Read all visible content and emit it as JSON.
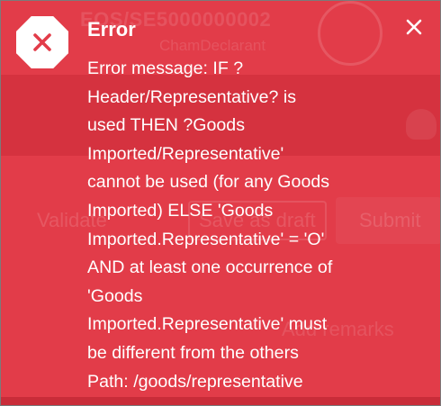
{
  "background": {
    "reference_number": "EOS/SE5000000002",
    "subtitle": "ChamDeclarant",
    "buttons": {
      "validate": "Validate",
      "save_draft": "Save as draft",
      "submit": "Submit",
      "add_remarks": "Add remarks"
    }
  },
  "toast": {
    "type": "error",
    "title": "Error",
    "icon": "error-x-icon",
    "close_icon": "close-icon",
    "message_lines": [
      "Error message: IF ?",
      "Header/Representative? is",
      "used THEN ?Goods",
      "Imported/Representative'",
      "cannot be used (for any Goods",
      "Imported) ELSE 'Goods",
      "Imported.Representative' = 'O'",
      "AND at least one occurrence of",
      "'Goods",
      "Imported.Representative' must",
      "be different from the others",
      "Path: /goods/representative"
    ]
  },
  "colors": {
    "toast_background": "#e03a48",
    "icon_x": "#e23c49",
    "text": "#ffffff"
  }
}
